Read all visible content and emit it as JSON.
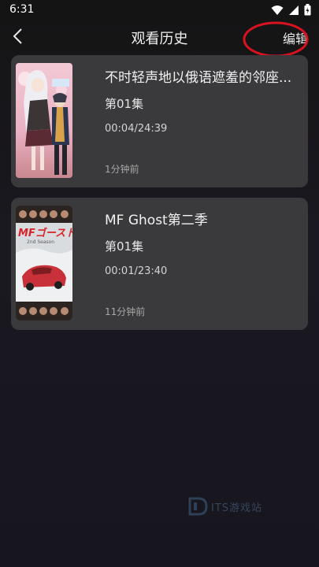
{
  "status": {
    "time": "6:31"
  },
  "header": {
    "title": "观看历史",
    "edit_label": "编辑"
  },
  "history": [
    {
      "title": "不时轻声地以俄语遮羞的邻座...",
      "episode": "第01集",
      "progress": "00:04/24:39",
      "time_ago": "1分钟前"
    },
    {
      "title": "MF Ghost第二季",
      "episode": "第01集",
      "progress": "00:01/23:40",
      "time_ago": "11分钟前"
    }
  ],
  "posters": {
    "mf_ghost_logo": "MFゴースト",
    "mf_ghost_sub": "2nd Season"
  },
  "watermark": {
    "text": "ITS游戏站"
  },
  "colors": {
    "annotation": "#d8131f",
    "card_bg": "#3a3a3c"
  }
}
